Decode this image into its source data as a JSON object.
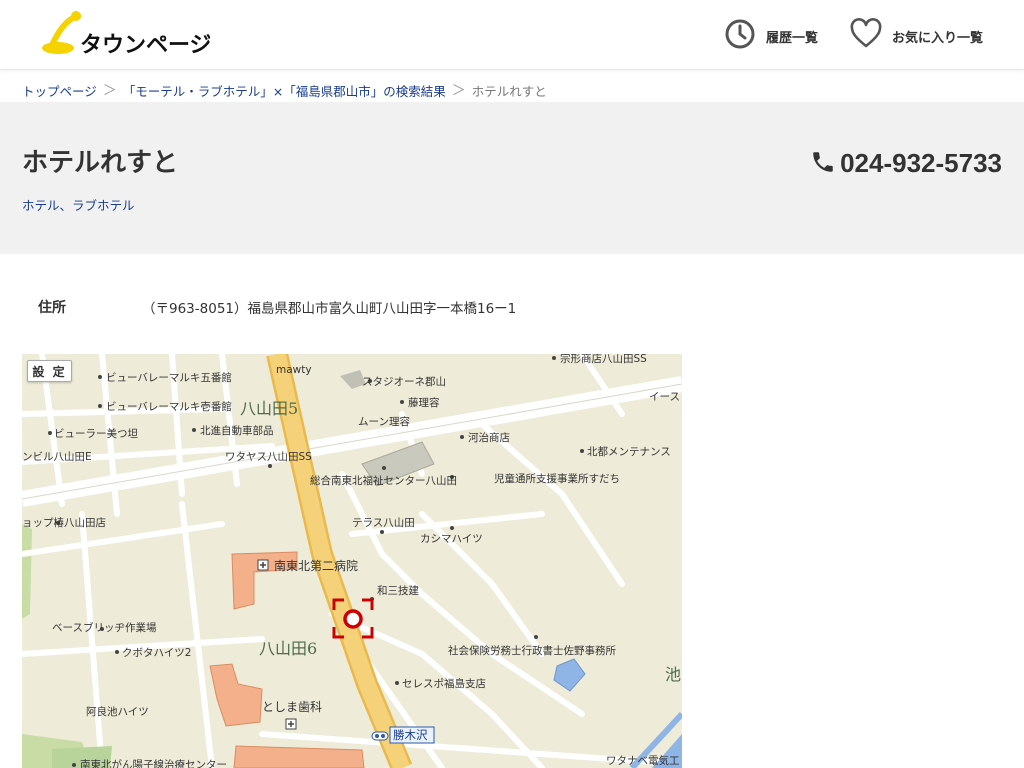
{
  "header": {
    "logo_text": "タウンページ",
    "history_label": "履歴一覧",
    "favorites_label": "お気に入り一覧"
  },
  "breadcrumb": {
    "items": [
      "トップページ",
      "「モーテル・ラブホテル」×「福島県郡山市」の検索結果"
    ],
    "current": "ホテルれすと"
  },
  "listing": {
    "title": "ホテルれすと",
    "categories": [
      "ホテル",
      "ラブホテル"
    ],
    "category_separator": "、",
    "phone": "024-932-5733"
  },
  "address": {
    "label": "住所",
    "value": "（〒963-8051）福島県郡山市富久山町八山田字一本橋16ー1"
  },
  "map": {
    "settings_label": "設 定",
    "area_labels": [
      "八山田5",
      "八山田6"
    ],
    "corner_label": "池",
    "station_label": "勝木沢",
    "places": [
      "宗形商店八山田SS",
      "mawty",
      "ビューバレーマルキ五番館",
      "スタジオーネ郡山",
      "イース",
      "ビューバレーマルキ壱番館",
      "藤理容",
      "ムーン理容",
      "ビューラー美つ坦",
      "北進自動車部品",
      "河治商店",
      "北都メンテナンス",
      "ンビル八山田E",
      "ワタヤス八山田SS",
      "総合南東北福祉センター八山田",
      "児童通所支援事業所すだち",
      "ョップ椿八山田店",
      "テラス八山田",
      "カシマハイツ",
      "南東北第二病院",
      "和三技建",
      "ベースブリッヂ作業場",
      "クボタハイツ2",
      "社会保険労務士行政書士佐野事務所",
      "セレスポ福島支店",
      "阿良池ハイツ",
      "としま歯科",
      "南東北がん陽子線治療センター",
      "ワタナベ電気工"
    ]
  },
  "colors": {
    "link": "#1a3c8c",
    "logo_yellow": "#f5d200",
    "map_road_highlight": "#f5d27a",
    "map_building": "#f4b08a",
    "map_marker": "#cc0000"
  }
}
